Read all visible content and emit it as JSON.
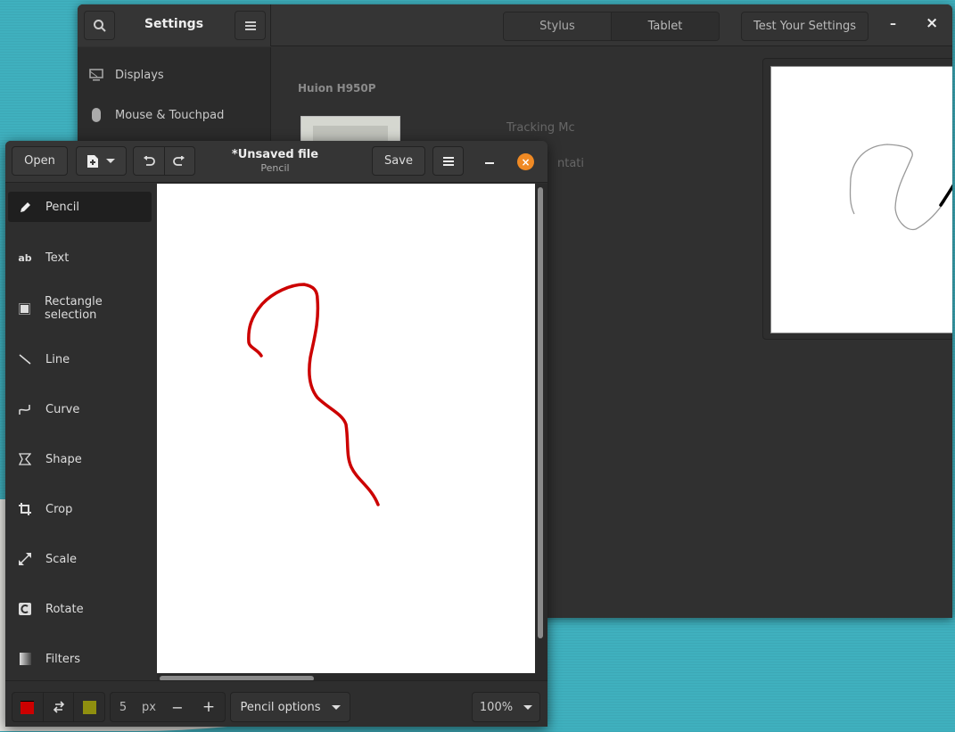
{
  "settings": {
    "title": "Settings",
    "sidebar": [
      {
        "label": "Displays",
        "icon": "display-icon"
      },
      {
        "label": "Mouse & Touchpad",
        "icon": "mouse-icon"
      }
    ],
    "tabs": [
      {
        "label": "Stylus",
        "active": false
      },
      {
        "label": "Tablet",
        "active": true
      }
    ],
    "test_button": "Test Your Settings",
    "device_name": "Huion H950P",
    "field_labels": [
      "Tracking Mc",
      "ntati"
    ],
    "minimize": "–",
    "close": "×"
  },
  "paint": {
    "title": "*Unsaved file",
    "subtitle": "Pencil",
    "open_label": "Open",
    "save_label": "Save",
    "tools": [
      {
        "label": "Pencil",
        "icon": "pencil-icon",
        "active": true
      },
      {
        "label": "Text",
        "icon": "text-icon",
        "active": false
      },
      {
        "label": "Rectangle selection",
        "icon": "rectangle-selection-icon",
        "active": false
      },
      {
        "label": "Line",
        "icon": "line-icon",
        "active": false
      },
      {
        "label": "Curve",
        "icon": "curve-icon",
        "active": false
      },
      {
        "label": "Shape",
        "icon": "shape-icon",
        "active": false
      },
      {
        "label": "Crop",
        "icon": "crop-icon",
        "active": false
      },
      {
        "label": "Scale",
        "icon": "scale-icon",
        "active": false
      },
      {
        "label": "Rotate",
        "icon": "rotate-icon",
        "active": false
      },
      {
        "label": "Filters",
        "icon": "filters-icon",
        "active": false
      }
    ],
    "bottom": {
      "primary_color": "#cc0000",
      "secondary_color": "#8f8f0f",
      "size_value": "5",
      "size_unit": "px",
      "minus": "−",
      "plus": "+",
      "options_label": "Pencil options",
      "zoom": "100%"
    }
  }
}
